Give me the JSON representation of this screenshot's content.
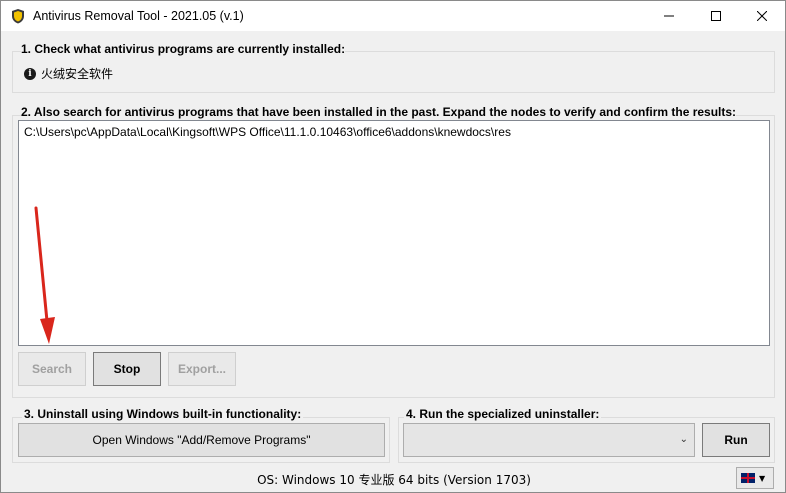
{
  "window": {
    "title": "Antivirus Removal Tool - 2021.05 (v.1)"
  },
  "section1": {
    "label": "1. Check what antivirus programs are currently installed:",
    "installed_items": [
      "火绒安全软件"
    ]
  },
  "section2": {
    "label": "2. Also search for antivirus programs that have been installed in the past. Expand the nodes to verify and confirm the results:",
    "results": [
      "C:\\Users\\pc\\AppData\\Local\\Kingsoft\\WPS Office\\11.1.0.10463\\office6\\addons\\knewdocs\\res"
    ],
    "search_label": "Search",
    "stop_label": "Stop",
    "export_label": "Export..."
  },
  "section3": {
    "label": "3. Uninstall using Windows built-in functionality:",
    "button_label": "Open Windows \"Add/Remove Programs\""
  },
  "section4": {
    "label": "4. Run the specialized uninstaller:",
    "combo_value": "",
    "run_label": "Run"
  },
  "status": {
    "os_text": "OS: Windows 10 专业版 64 bits (Version 1703)"
  },
  "colors": {
    "annotation_arrow": "#d9261c"
  },
  "icons": {
    "app": "shield-logo-icon",
    "info": "info-icon",
    "language": "uk-flag-icon"
  }
}
